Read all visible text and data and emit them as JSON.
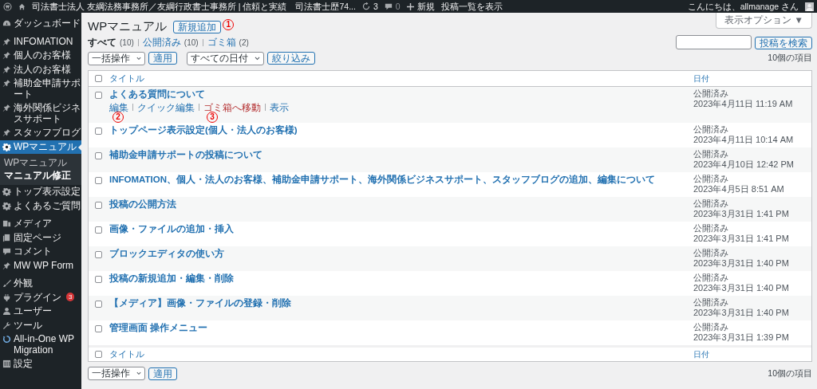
{
  "admin_bar": {
    "site_title": "司法書士法人 友綱法務事務所／友綱行政書士事務所 | 信頼と実績　司法書士歴74...",
    "updates_count": "3",
    "comments_count": "0",
    "new_label": "新規",
    "view_label": "投稿一覧を表示",
    "greeting": "こんにちは、allmanage さん"
  },
  "sidebar": {
    "sections": [
      {
        "items": [
          {
            "label": "ダッシュボード",
            "kind": "dashboard",
            "selected": false
          }
        ]
      },
      {
        "items": [
          {
            "label": "INFOMATION",
            "kind": "pin",
            "selected": false
          },
          {
            "label": "個人のお客様",
            "kind": "pin",
            "selected": false
          },
          {
            "label": "法人のお客様",
            "kind": "pin",
            "selected": false
          },
          {
            "label": "補助金申請サポート",
            "kind": "pin",
            "selected": false
          },
          {
            "label": "海外関係ビジネスサポート",
            "kind": "pin",
            "selected": false
          },
          {
            "label": "スタッフブログ",
            "kind": "pin",
            "selected": false
          },
          {
            "label": "WPマニュアル",
            "kind": "gear",
            "selected": true,
            "children": [
              {
                "label": "WPマニュアル",
                "selected": false
              },
              {
                "label": "マニュアル修正",
                "selected": true
              }
            ]
          },
          {
            "label": "トップ表示設定",
            "kind": "gear",
            "selected": false
          },
          {
            "label": "よくあるご質問",
            "kind": "gear",
            "selected": false
          }
        ]
      },
      {
        "items": [
          {
            "label": "メディア",
            "kind": "media",
            "selected": false
          },
          {
            "label": "固定ページ",
            "kind": "page",
            "selected": false
          },
          {
            "label": "コメント",
            "kind": "comment",
            "selected": false
          },
          {
            "label": "MW WP Form",
            "kind": "pin",
            "selected": false
          }
        ]
      },
      {
        "items": [
          {
            "label": "外観",
            "kind": "brush",
            "selected": false
          },
          {
            "label": "プラグイン",
            "kind": "plugin",
            "selected": false,
            "badge": "3"
          },
          {
            "label": "ユーザー",
            "kind": "user",
            "selected": false
          },
          {
            "label": "ツール",
            "kind": "wrench",
            "selected": false
          },
          {
            "label": "All-in-One WP Migration",
            "kind": "migration",
            "selected": false
          },
          {
            "label": "設定",
            "kind": "settings",
            "selected": false
          }
        ]
      }
    ]
  },
  "page": {
    "title": "WPマニュアル",
    "add_new": {
      "label": "新規追加",
      "annotation": "1"
    },
    "screen_options": "表示オプション ▼"
  },
  "views": [
    {
      "label": "すべて",
      "count": "(10)",
      "selected": true
    },
    {
      "label": "公開済み",
      "count": "(10)",
      "selected": false
    },
    {
      "label": "ゴミ箱",
      "count": "(2)",
      "selected": false
    }
  ],
  "search": {
    "button": "投稿を検索"
  },
  "top_nav": {
    "bulk_action": "一括操作",
    "apply": "適用",
    "date_filter": "すべての日付",
    "filter": "絞り込み",
    "items_count": "10個の項目"
  },
  "table": {
    "columns": [
      "タイトル",
      "日付"
    ],
    "header_checked": false,
    "rows": [
      {
        "title": "よくある質問について",
        "status": "公開済み",
        "date": "2023年4月11日 11:19 AM",
        "checked": false,
        "row_actions": [
          {
            "label": "編集",
            "kind": "normal",
            "annotation": "2"
          },
          {
            "label": "クイック編集",
            "kind": "normal"
          },
          {
            "label": "ゴミ箱へ移動",
            "kind": "trash",
            "annotation": "3"
          },
          {
            "label": "表示",
            "kind": "normal"
          }
        ]
      },
      {
        "title": "トップページ表示設定(個人・法人のお客様)",
        "status": "公開済み",
        "date": "2023年4月11日 10:14 AM",
        "checked": false
      },
      {
        "title": "補助金申請サポートの投稿について",
        "status": "公開済み",
        "date": "2023年4月10日 12:42 PM",
        "checked": false
      },
      {
        "title": "INFOMATION、個人・法人のお客様、補助金申請サポート、海外関係ビジネスサポート、スタッフブログの追加、編集について",
        "status": "公開済み",
        "date": "2023年4月5日 8:51 AM",
        "checked": false
      },
      {
        "title": "投稿の公開方法",
        "status": "公開済み",
        "date": "2023年3月31日 1:41 PM",
        "checked": false
      },
      {
        "title": "画像・ファイルの追加・挿入",
        "status": "公開済み",
        "date": "2023年3月31日 1:41 PM",
        "checked": false
      },
      {
        "title": "ブロックエディタの使い方",
        "status": "公開済み",
        "date": "2023年3月31日 1:40 PM",
        "checked": false
      },
      {
        "title": "投稿の新規追加・編集・削除",
        "status": "公開済み",
        "date": "2023年3月31日 1:40 PM",
        "checked": false
      },
      {
        "title": "【メディア】画像・ファイルの登録・削除",
        "status": "公開済み",
        "date": "2023年3月31日 1:40 PM",
        "checked": false
      },
      {
        "title": "管理画面 操作メニュー",
        "status": "公開済み",
        "date": "2023年3月31日 1:39 PM",
        "checked": false
      }
    ],
    "footer_columns": [
      "タイトル",
      "日付"
    ],
    "footer_checked": false
  },
  "bottom_nav": {
    "bulk_action": "一括操作",
    "apply": "適用",
    "items_count": "10個の項目"
  }
}
